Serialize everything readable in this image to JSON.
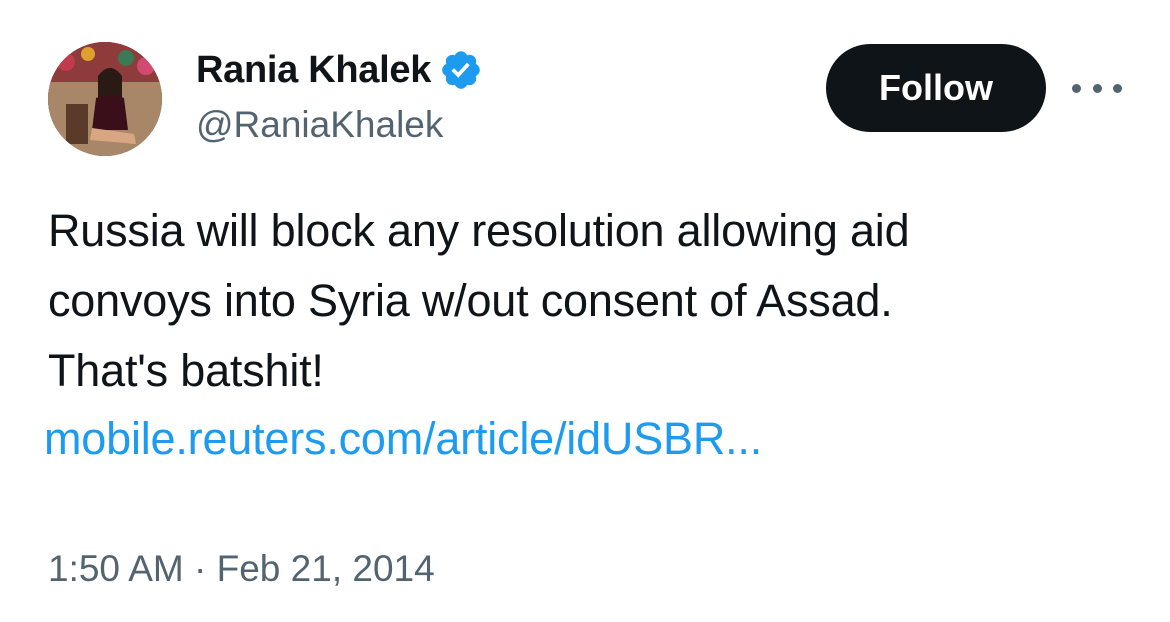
{
  "author": {
    "display_name": "Rania Khalek",
    "handle": "@RaniaKhalek",
    "verified": true,
    "verified_color": "#1d9bf0"
  },
  "actions": {
    "follow_label": "Follow",
    "more_icon": "more-horizontal-icon"
  },
  "tweet": {
    "text_lines": [
      "Russia will block any resolution allowing aid",
      "convoys into Syria w/out consent of Assad.",
      "That's batshit!"
    ],
    "link_text": "mobile.reuters.com/article/idUSBR...",
    "timestamp": "1:50 AM · Feb 21, 2014"
  },
  "colors": {
    "text": "#0f1419",
    "secondary": "#536471",
    "link": "#1d9bf0",
    "button_bg": "#0f1419"
  }
}
